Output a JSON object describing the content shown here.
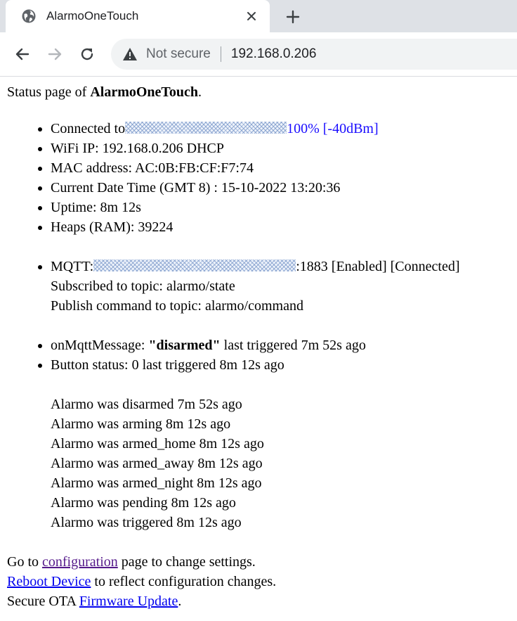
{
  "browser": {
    "tab_title": "AlarmoOneTouch",
    "security_label": "Not secure",
    "url": "192.168.0.206"
  },
  "page": {
    "intro_prefix": "Status page of ",
    "intro_name": "AlarmoOneTouch",
    "intro_suffix": ".",
    "network": {
      "connected_label": "Connected to",
      "signal": "100% [-40dBm]",
      "wifi_ip": "WiFi IP: 192.168.0.206 DHCP",
      "mac": "MAC address: AC:0B:FB:CF:F7:74",
      "datetime": "Current Date Time (GMT 8) : 15-10-2022 13:20:36",
      "uptime": "Uptime: 8m 12s",
      "heaps": "Heaps (RAM): 39224"
    },
    "mqtt": {
      "label": "MQTT:",
      "status": ":1883 [Enabled] [Connected]",
      "subscribed": "Subscribed to topic: alarmo/state",
      "publish": "Publish command to topic: alarmo/command"
    },
    "message": {
      "prefix": "onMqttMessage: ",
      "value": "\"disarmed\"",
      "suffix": " last triggered 7m 52s ago",
      "button_status": "Button status: 0 last triggered 8m 12s ago"
    },
    "history": [
      "Alarmo was disarmed 7m 52s ago",
      "Alarmo was arming 8m 12s ago",
      "Alarmo was armed_home 8m 12s ago",
      "Alarmo was armed_away 8m 12s ago",
      "Alarmo was armed_night 8m 12s ago",
      "Alarmo was pending 8m 12s ago",
      "Alarmo was triggered 8m 12s ago"
    ],
    "footer": {
      "goto_prefix": "Go to ",
      "config_link": "configuration",
      "goto_suffix": " page to change settings.",
      "reboot_link": "Reboot Device",
      "reboot_suffix": " to reflect configuration changes.",
      "ota_prefix": "Secure OTA ",
      "firmware_link": "Firmware Update",
      "ota_suffix": "."
    }
  },
  "colors": {
    "signal": "#1a0dff",
    "link": "#0000ee",
    "visited_link": "#551a8b"
  }
}
